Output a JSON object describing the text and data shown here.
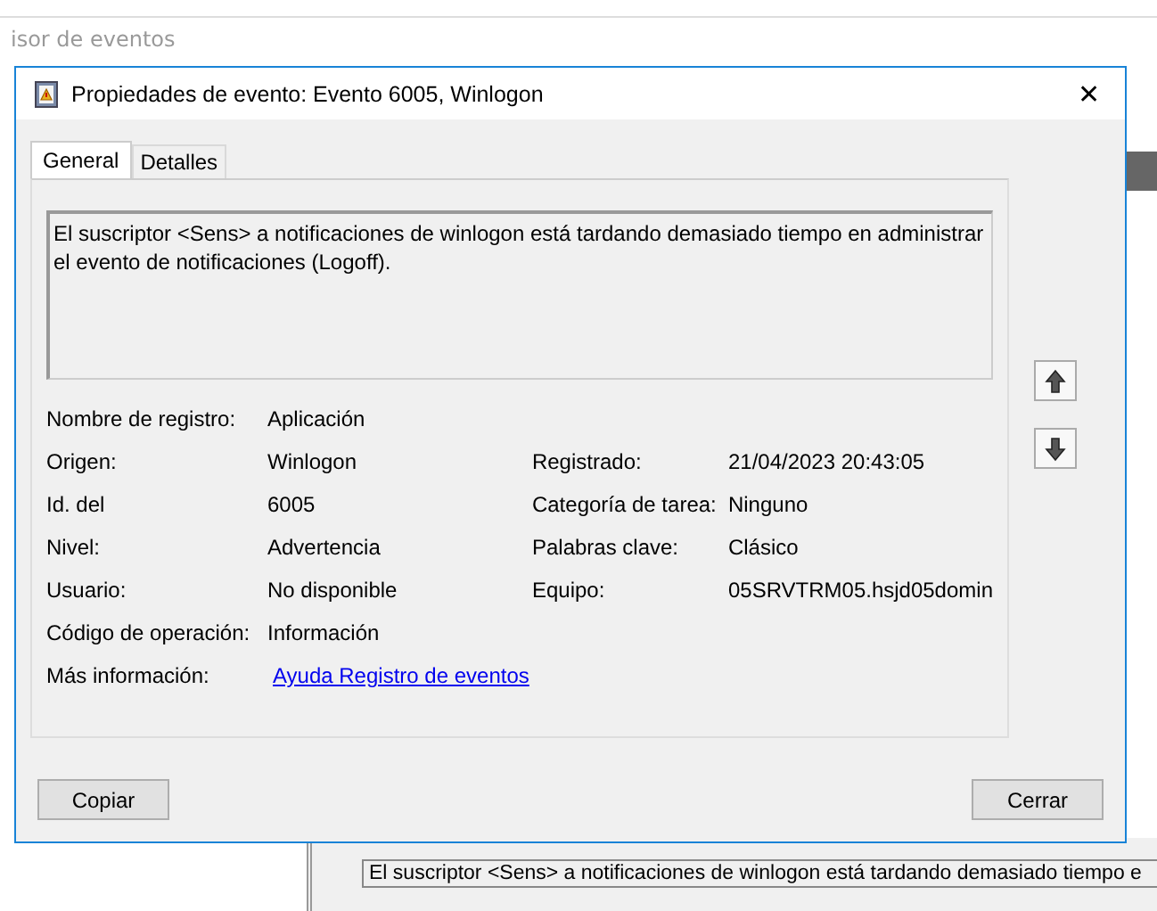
{
  "background_window": {
    "title": "isor de eventos",
    "preview_text": "El suscriptor <Sens> a notificaciones de winlogon está tardando demasiado tiempo e"
  },
  "dialog": {
    "title": "Propiedades de evento: Evento 6005, Winlogon",
    "close": "✕",
    "tabs": [
      {
        "label": "General",
        "selected": true
      },
      {
        "label": "Detalles",
        "selected": false
      }
    ],
    "message": "El suscriptor <Sens> a notificaciones de winlogon está tardando demasiado tiempo en administrar el evento de notificaciones (Logoff).",
    "fields_left": [
      {
        "label": "Nombre de registro:",
        "value": "Aplicación"
      },
      {
        "label": "Origen:",
        "value": "Winlogon"
      },
      {
        "label": "Id. del",
        "value": "6005"
      },
      {
        "label": "Nivel:",
        "value": "Advertencia"
      },
      {
        "label": "Usuario:",
        "value": "No disponible"
      },
      {
        "label": "Código de operación:",
        "value": "Información"
      }
    ],
    "fields_right": [
      {
        "label": "Registrado:",
        "value": "21/04/2023 20:43:05"
      },
      {
        "label": "Categoría de tarea:",
        "value": "Ninguno"
      },
      {
        "label": "Palabras clave:",
        "value": "Clásico"
      },
      {
        "label": "Equipo:",
        "value": "05SRVTRM05.hsjd05domin"
      }
    ],
    "more_info": {
      "label": "Más información:",
      "link": "Ayuda Registro de eventos"
    },
    "buttons": [
      "Copiar",
      "Cerrar"
    ]
  }
}
